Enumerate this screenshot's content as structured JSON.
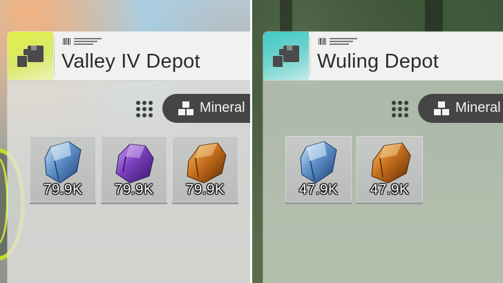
{
  "left": {
    "title": "Valley IV Depot",
    "filter_label": "Mineral",
    "items": [
      {
        "name": "blue-ore",
        "qty": "79.9K"
      },
      {
        "name": "amethyst-ore",
        "qty": "79.9K"
      },
      {
        "name": "amber-ore",
        "qty": "79.9K"
      }
    ]
  },
  "right": {
    "title": "Wuling Depot",
    "filter_label": "Mineral",
    "items": [
      {
        "name": "blue-ore",
        "qty": "47.9K"
      },
      {
        "name": "amber-ore",
        "qty": "47.9K"
      }
    ]
  },
  "colors": {
    "left_accent": "#e4f04a",
    "right_accent": "#3fc9c4"
  },
  "icons": [
    "depot-icon",
    "grid-view-icon",
    "mineral-category-icon"
  ]
}
